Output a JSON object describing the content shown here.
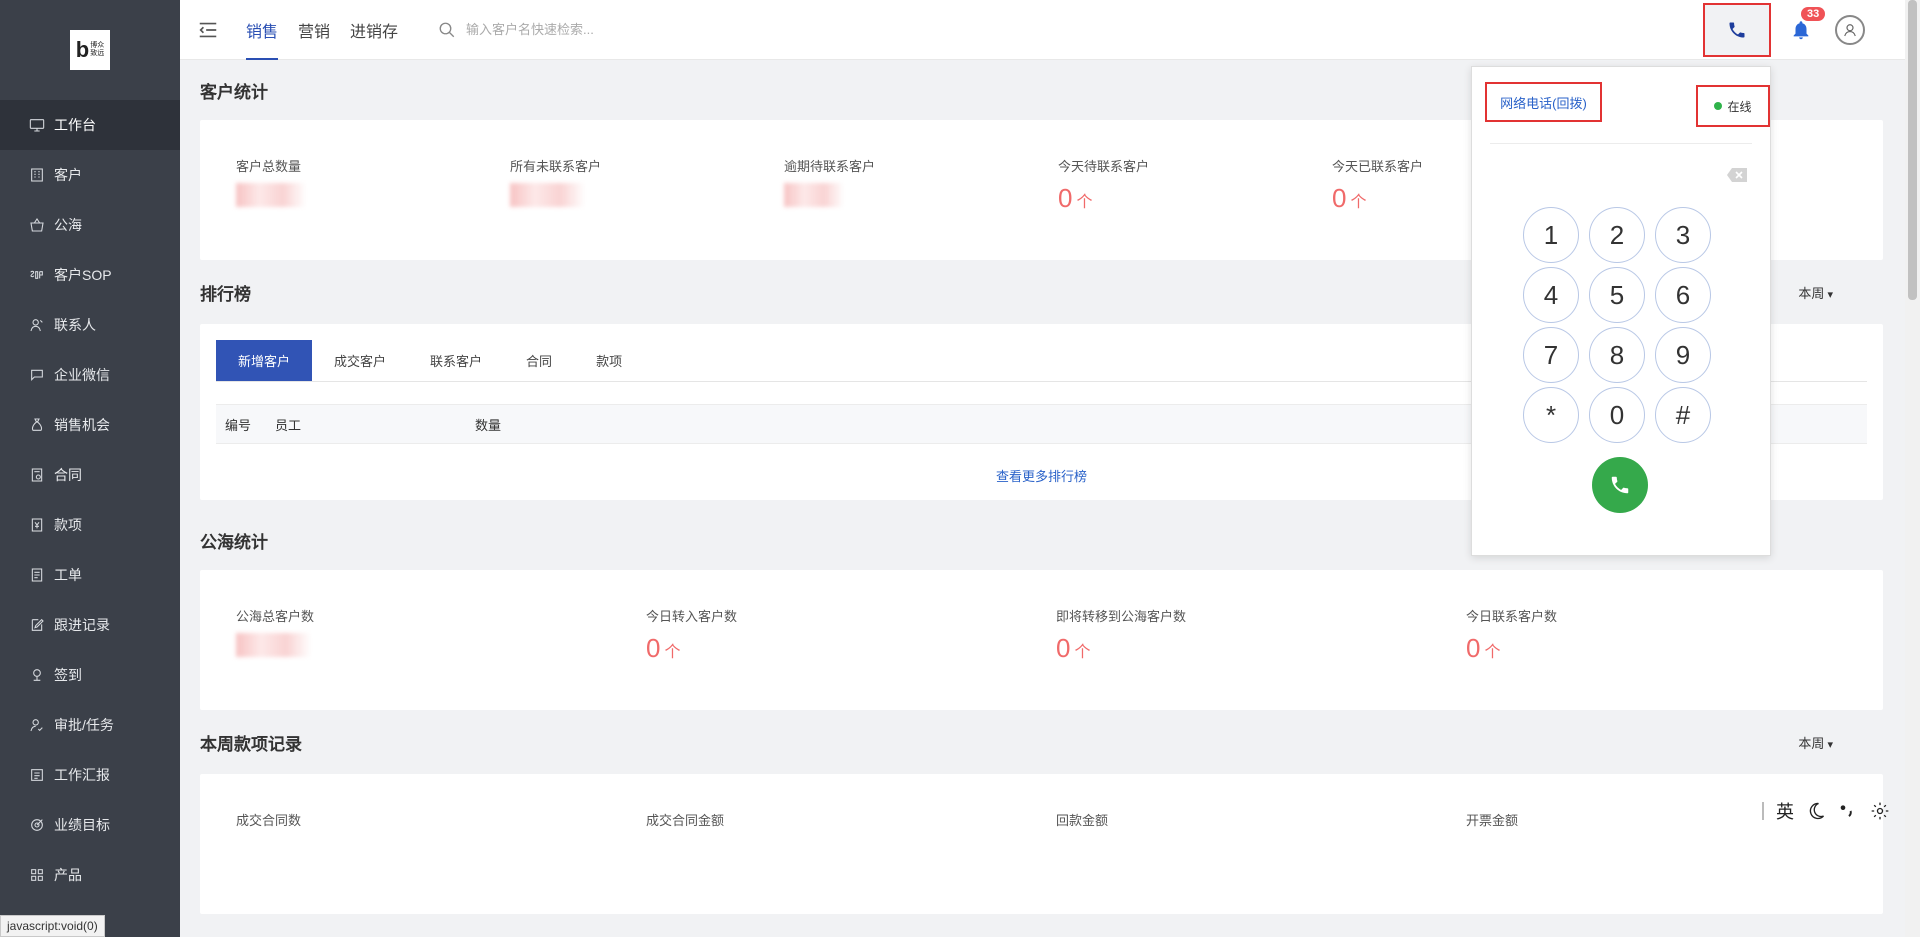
{
  "sidebar": {
    "logo": {
      "letter": "b",
      "line1": "博众",
      "line2": "致远"
    },
    "items": [
      {
        "label": "工作台",
        "icon": "monitor-icon",
        "active": true
      },
      {
        "label": "客户",
        "icon": "building-icon"
      },
      {
        "label": "公海",
        "icon": "basket-icon"
      },
      {
        "label": "客户SOP",
        "icon": "sop-icon"
      },
      {
        "label": "联系人",
        "icon": "person-icon"
      },
      {
        "label": "企业微信",
        "icon": "chat-icon"
      },
      {
        "label": "销售机会",
        "icon": "moneybag-icon"
      },
      {
        "label": "合同",
        "icon": "contract-icon"
      },
      {
        "label": "款项",
        "icon": "payment-icon"
      },
      {
        "label": "工单",
        "icon": "ticket-icon"
      },
      {
        "label": "跟进记录",
        "icon": "edit-icon"
      },
      {
        "label": "签到",
        "icon": "location-icon"
      },
      {
        "label": "审批/任务",
        "icon": "approval-icon"
      },
      {
        "label": "工作汇报",
        "icon": "report-icon"
      },
      {
        "label": "业绩目标",
        "icon": "target-icon"
      },
      {
        "label": "产品",
        "icon": "grid-icon"
      }
    ]
  },
  "statusbar": {
    "text": "javascript:void(0)"
  },
  "topbar": {
    "tabs": [
      "销售",
      "营销",
      "进销存"
    ],
    "search_placeholder": "输入客户名快速检索...",
    "notification_count": "33"
  },
  "customer_stats": {
    "title": "客户统计",
    "items": [
      {
        "label": "客户总数量",
        "value": "",
        "unit": "",
        "blurred": true
      },
      {
        "label": "所有未联系客户",
        "value": "",
        "unit": "",
        "blurred": true
      },
      {
        "label": "逾期待联系客户",
        "value": "",
        "unit": "",
        "blurred": true
      },
      {
        "label": "今天待联系客户",
        "value": "0",
        "unit": "个"
      },
      {
        "label": "今天已联系客户",
        "value": "0",
        "unit": "个"
      }
    ]
  },
  "ranking": {
    "title": "排行榜",
    "period": "本周",
    "tabs": [
      "新增客户",
      "成交客户",
      "联系客户",
      "合同",
      "款项"
    ],
    "columns": [
      "编号",
      "员工",
      "数量"
    ],
    "more_link": "查看更多排行榜"
  },
  "sea_stats": {
    "title": "公海统计",
    "items": [
      {
        "label": "公海总客户数",
        "value": "",
        "unit": "",
        "blurred": true
      },
      {
        "label": "今日转入客户数",
        "value": "0",
        "unit": "个"
      },
      {
        "label": "即将转移到公海客户数",
        "value": "0",
        "unit": "个"
      },
      {
        "label": "今日联系客户数",
        "value": "0",
        "unit": "个"
      }
    ]
  },
  "payment_records": {
    "title": "本周款项记录",
    "period": "本周",
    "items": [
      {
        "label": "成交合同数"
      },
      {
        "label": "成交合同金额"
      },
      {
        "label": "回款金额"
      },
      {
        "label": "开票金额"
      }
    ]
  },
  "dialpad": {
    "title": "网络电话(回拨)",
    "status": "在线",
    "keys": [
      "1",
      "2",
      "3",
      "4",
      "5",
      "6",
      "7",
      "8",
      "9",
      "*",
      "0",
      "#"
    ]
  },
  "ime": {
    "lang": "英"
  }
}
